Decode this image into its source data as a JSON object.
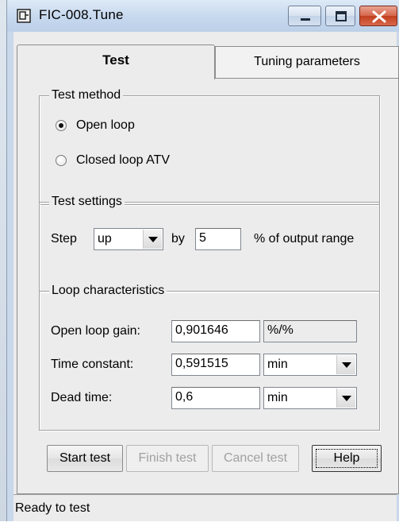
{
  "window": {
    "title": "FIC-008.Tune"
  },
  "tabs": [
    {
      "label": "Test",
      "selected": true
    },
    {
      "label": "Tuning parameters",
      "selected": false
    }
  ],
  "test_method": {
    "title": "Test method",
    "options": [
      {
        "label": "Open loop",
        "checked": true
      },
      {
        "label": "Closed loop ATV",
        "checked": false
      }
    ]
  },
  "test_settings": {
    "title": "Test settings",
    "step_label": "Step",
    "step_direction": "up",
    "by_label": "by",
    "step_size": "5",
    "unit_label": "% of output range"
  },
  "loop_characteristics": {
    "title": "Loop characteristics",
    "open_loop_gain": {
      "label": "Open loop gain:",
      "value": "0,901646",
      "unit": "%/%"
    },
    "time_constant": {
      "label": "Time constant:",
      "value": "0,591515",
      "unit": "min"
    },
    "dead_time": {
      "label": "Dead time:",
      "value": "0,6",
      "unit": "min"
    }
  },
  "buttons": {
    "start": "Start test",
    "finish": "Finish test",
    "cancel": "Cancel test",
    "help": "Help"
  },
  "status": {
    "text": "Ready to test"
  },
  "colors": {
    "close_button": "#c2401f",
    "titlebar": "#c6d8ee"
  }
}
